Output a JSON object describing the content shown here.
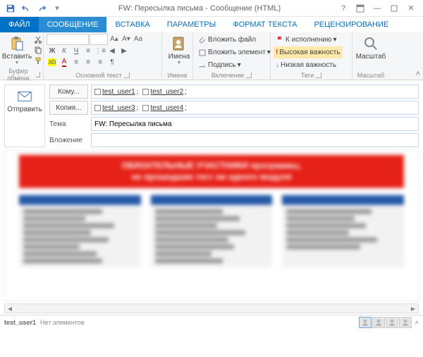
{
  "title": "FW: Пересылка письма - Сообщение (HTML)",
  "tabs": {
    "file": "ФАЙЛ",
    "message": "СООБЩЕНИЕ",
    "insert": "ВСТАВКА",
    "options": "ПАРАМЕТРЫ",
    "format": "ФОРМАТ ТЕКСТА",
    "review": "РЕЦЕНЗИРОВАНИЕ"
  },
  "ribbon": {
    "clipboard": {
      "paste": "Вставить",
      "label": "Буфер обмена"
    },
    "font": {
      "label": "Основной текст"
    },
    "names": {
      "btn": "Имена",
      "label": "Имена"
    },
    "include": {
      "attach_file": "Вложить файл",
      "attach_item": "Вложить элемент",
      "signature": "Подпись",
      "label": "Включение"
    },
    "tags": {
      "follow_up": "К исполнению",
      "high": "Высокая важность",
      "low": "Низкая важность",
      "label": "Теги"
    },
    "zoom": {
      "btn": "Масштаб",
      "label": "Масштаб"
    }
  },
  "compose": {
    "send": "Отправить",
    "to_btn": "Кому...",
    "cc_btn": "Копия...",
    "subject_label": "Тема",
    "attach_label": "Вложение",
    "subject_value": "FW: Пересылка письма",
    "to": [
      "test_user1",
      "test_user2"
    ],
    "cc": [
      "test_user3",
      "test_user4"
    ]
  },
  "body": {
    "banner_l1": "ОБЯЗАТЕЛЬНЫЕ УЧАСТНИКИ программы,",
    "banner_l2": "не прошедшие тест ни одного модуля"
  },
  "status": {
    "user": "test_user1",
    "msg": "Нет элементов"
  },
  "chart_data": {
    "type": "table",
    "note": "Body content is a blurred embedded table with a red banner and three blue-headed columns; cell text is illegible in the screenshot."
  }
}
